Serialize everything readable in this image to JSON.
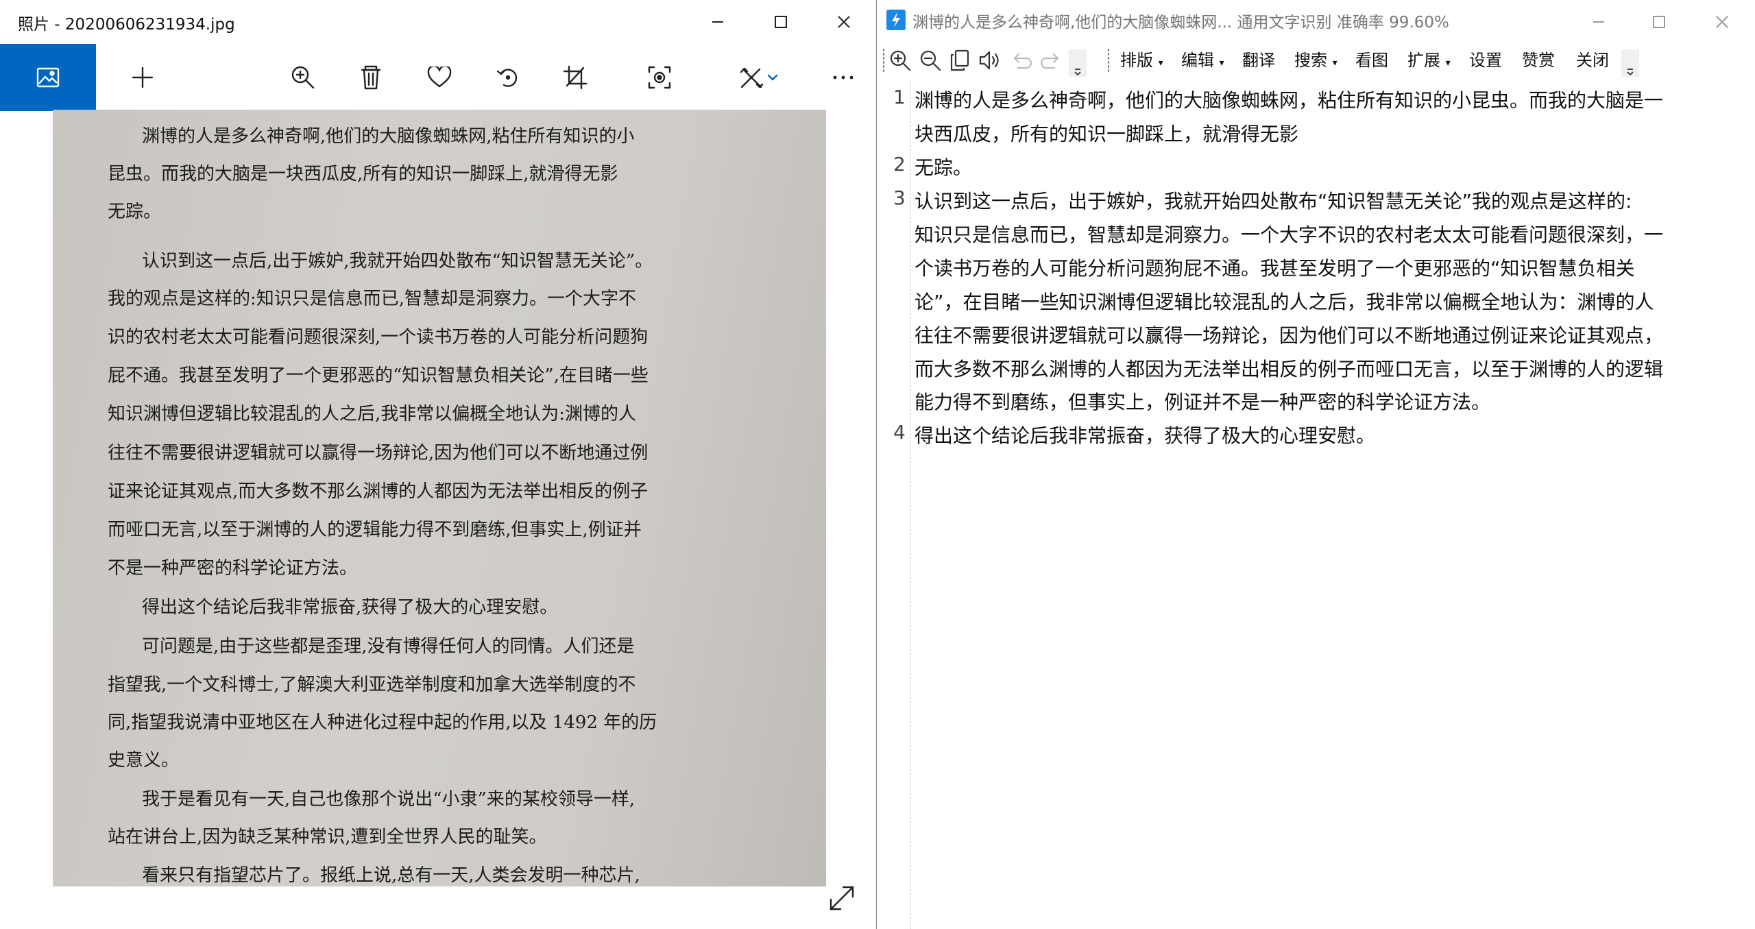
{
  "photos": {
    "title": "照片 - 20200606231934.jpg",
    "page_lines": [
      "渊博的人是多么神奇啊,他们的大脑像蜘蛛网,粘住所有知识的小",
      "昆虫。而我的大脑是一块西瓜皮,所有的知识一脚踩上,就滑得无影",
      "无踪。",
      "认识到这一点后,出于嫉妒,我就开始四处散布“知识智慧无关论”。",
      "我的观点是这样的:知识只是信息而已,智慧却是洞察力。一个大字不",
      "识的农村老太太可能看问题很深刻,一个读书万卷的人可能分析问题狗",
      "屁不通。我甚至发明了一个更邪恶的“知识智慧负相关论”,在目睹一些",
      "知识渊博但逻辑比较混乱的人之后,我非常以偏概全地认为:渊博的人",
      "往往不需要很讲逻辑就可以赢得一场辩论,因为他们可以不断地通过例",
      "证来论证其观点,而大多数不那么渊博的人都因为无法举出相反的例子",
      "而哑口无言,以至于渊博的人的逻辑能力得不到磨练,但事实上,例证并",
      "不是一种严密的科学论证方法。",
      "得出这个结论后我非常振奋,获得了极大的心理安慰。",
      "可问题是,由于这些都是歪理,没有博得任何人的同情。人们还是",
      "指望我,一个文科博士,了解澳大利亚选举制度和加拿大选举制度的不",
      "同,指望我说清中亚地区在人种进化过程中起的作用,以及 1492 年的历",
      "史意义。",
      "我于是看见有一天,自己也像那个说出“小隶”来的某校领导一样,",
      "站在讲台上,因为缺乏某种常识,遭到全世界人民的耻笑。",
      "看来只有指望芯片了。报纸上说,总有一天,人类会发明一种芯片,"
    ]
  },
  "ocr": {
    "title": "渊博的人是多么神奇啊,他们的大脑像蜘蛛网...    通用文字识别 准确率 99.60%",
    "menus": {
      "layout": "排版",
      "edit": "编辑",
      "translate": "翻译",
      "search": "搜索",
      "view_image": "看图",
      "extend": "扩展",
      "settings": "设置",
      "donate": "赞赏",
      "close": "关闭"
    },
    "line_numbers": [
      "1",
      "2",
      "3",
      "4"
    ],
    "lines": [
      "渊博的人是多么神奇啊，他们的大脑像蜘蛛网，粘住所有知识的小昆虫。而我的大脑是一",
      "块西瓜皮，所有的知识一脚踩上，就滑得无影",
      "无踪。",
      "认识到这一点后，出于嫉妒，我就开始四处散布“知识智慧无关论”我的观点是这样的:",
      "知识只是信息而已，智慧却是洞察力。一个大字不识的农村老太太可能看问题很深刻，一",
      "个读书万卷的人可能分析问题狗屁不通。我甚至发明了一个更邪恶的“知识智慧负相关",
      "论”，在目睹一些知识渊博但逻辑比较混乱的人之后，我非常以偏概全地认为：渊博的人",
      "往往不需要很讲逻辑就可以赢得一场辩论，因为他们可以不断地通过例证来论证其观点，",
      "而大多数不那么渊博的人都因为无法举出相反的例子而哑口无言，以至于渊博的人的逻辑",
      "能力得不到磨练，但事实上，例证并不是一种严密的科学论证方法。",
      "得出这个结论后我非常振奋，获得了极大的心理安慰。"
    ]
  }
}
